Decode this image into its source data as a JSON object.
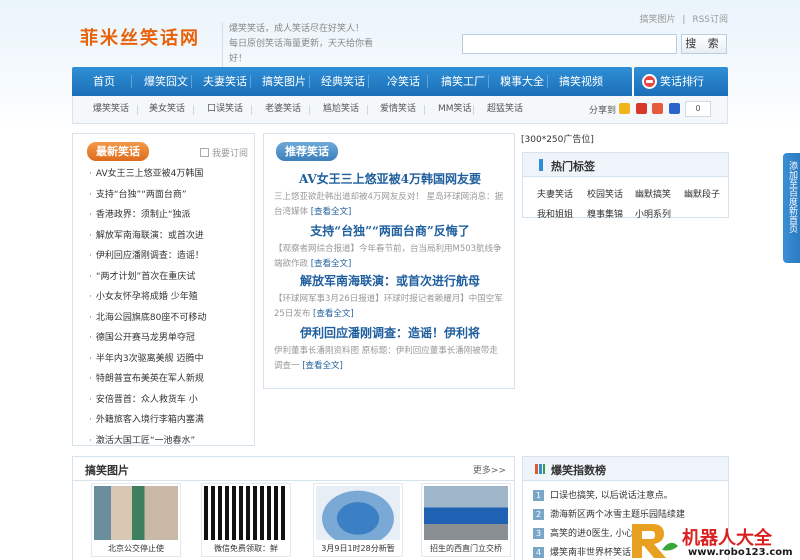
{
  "header": {
    "logo": "菲米丝笑话网",
    "slogan_lines": [
      "爆笑笑话，成人笑话尽在好笑人！",
      "每日原创笑话海量更新，天天给你看好！"
    ],
    "toplinks": [
      "搞笑图片",
      "RSS订阅"
    ],
    "search_placeholder": "",
    "search_button": "搜 索"
  },
  "mainnav": [
    "首页",
    "爆笑囧文",
    "夫妻笑话",
    "搞笑图片",
    "经典笑话",
    "冷笑话",
    "搞笑工厂",
    "糗事大全",
    "搞笑视频"
  ],
  "rank_button": "笑话排行",
  "subnav": [
    "爆笑笑话",
    "美女笑话",
    "口误笑话",
    "老婆笑话",
    "尴尬笑话",
    "爱情笑话",
    "MM笑话",
    "超猛笑话"
  ],
  "share": {
    "label": "分享到",
    "count": "0"
  },
  "latest": {
    "title": "最新笑话",
    "subscribe": "我要订阅",
    "items": [
      "AV女王三上悠亚被4万韩国",
      "支持“台独”“两面台商”",
      "香港政界：须制止“独派",
      "解放军南海联演：或首次进",
      "伊利回应潘刚调查：造谣！",
      "“两才计划”首次在重庆试",
      "小女友怀孕将成婚 少年殖",
      "北海公园旗底80座不可移动",
      "德国公开赛马龙男单夺冠",
      "半年内3次驱离美舰 迈腾中",
      "特朗普宣布美英在军人新规",
      "安倍晋首：众人救货车 小",
      "外籍旅客入境行李箱内塞满",
      "激活大国工匠“一池春水”"
    ]
  },
  "recommend": {
    "title": "推荐笑话",
    "more_label": "[查看全文]",
    "items": [
      {
        "title": "AV女王三上悠亚被4万韩国网友要",
        "summary": "三上悠亚欲赴韩出道却被4万网友反对！ 星岛环球网消息：据台湾媒体"
      },
      {
        "title": "支持“台独”“两面台商”反悔了",
        "summary": "【观察者网综合报道】今年春节前，台当局利用M503航线争端欲作政"
      },
      {
        "title": "解放军南海联演：或首次进行航母",
        "summary": "【环球网军事3月26日报道】环球时报记者赖耀月】中国空军25日发布"
      },
      {
        "title": "伊利回应潘刚调查：造谣！伊利将",
        "summary": "伊利董事长潘刚资料图 原标题：伊利回应董事长潘刚被带走调查一"
      }
    ]
  },
  "ad_label": "[300*250广告位]",
  "hot_tags": {
    "title": "热门标签",
    "tags": [
      "夫妻笑话",
      "校园笑话",
      "幽默搞笑",
      "幽默段子",
      "我和姐姐",
      "糗事集锦",
      "小明系列"
    ]
  },
  "side_button": "添加至百度新首页",
  "funny_pics": {
    "title": "搞笑图片",
    "more": "更多>>",
    "items": [
      "北京公交停止使",
      "微信免费领取：鲜",
      "3月9日1时28分新暂",
      "招生的西直门立交桥"
    ]
  },
  "joke_index": {
    "title": "爆笑指数榜",
    "items": [
      {
        "rank": "1",
        "text": "口误也搞笑, 以后说话注意点。"
      },
      {
        "rank": "2",
        "text": "渤海新区两个冰雪主题乐园陆续建"
      },
      {
        "rank": "3",
        "text": "高笑的进0医生, 小心"
      },
      {
        "rank": "4",
        "text": "爆笑南非世界杯笑话"
      }
    ]
  },
  "watermark": {
    "text": "机器人大全",
    "url": "www.robo123.com"
  },
  "colors": {
    "nav_blue": "#1f7cc4",
    "accent_orange": "#e8620a",
    "link_blue": "#1f5f9e",
    "watermark_red": "#d92020"
  }
}
